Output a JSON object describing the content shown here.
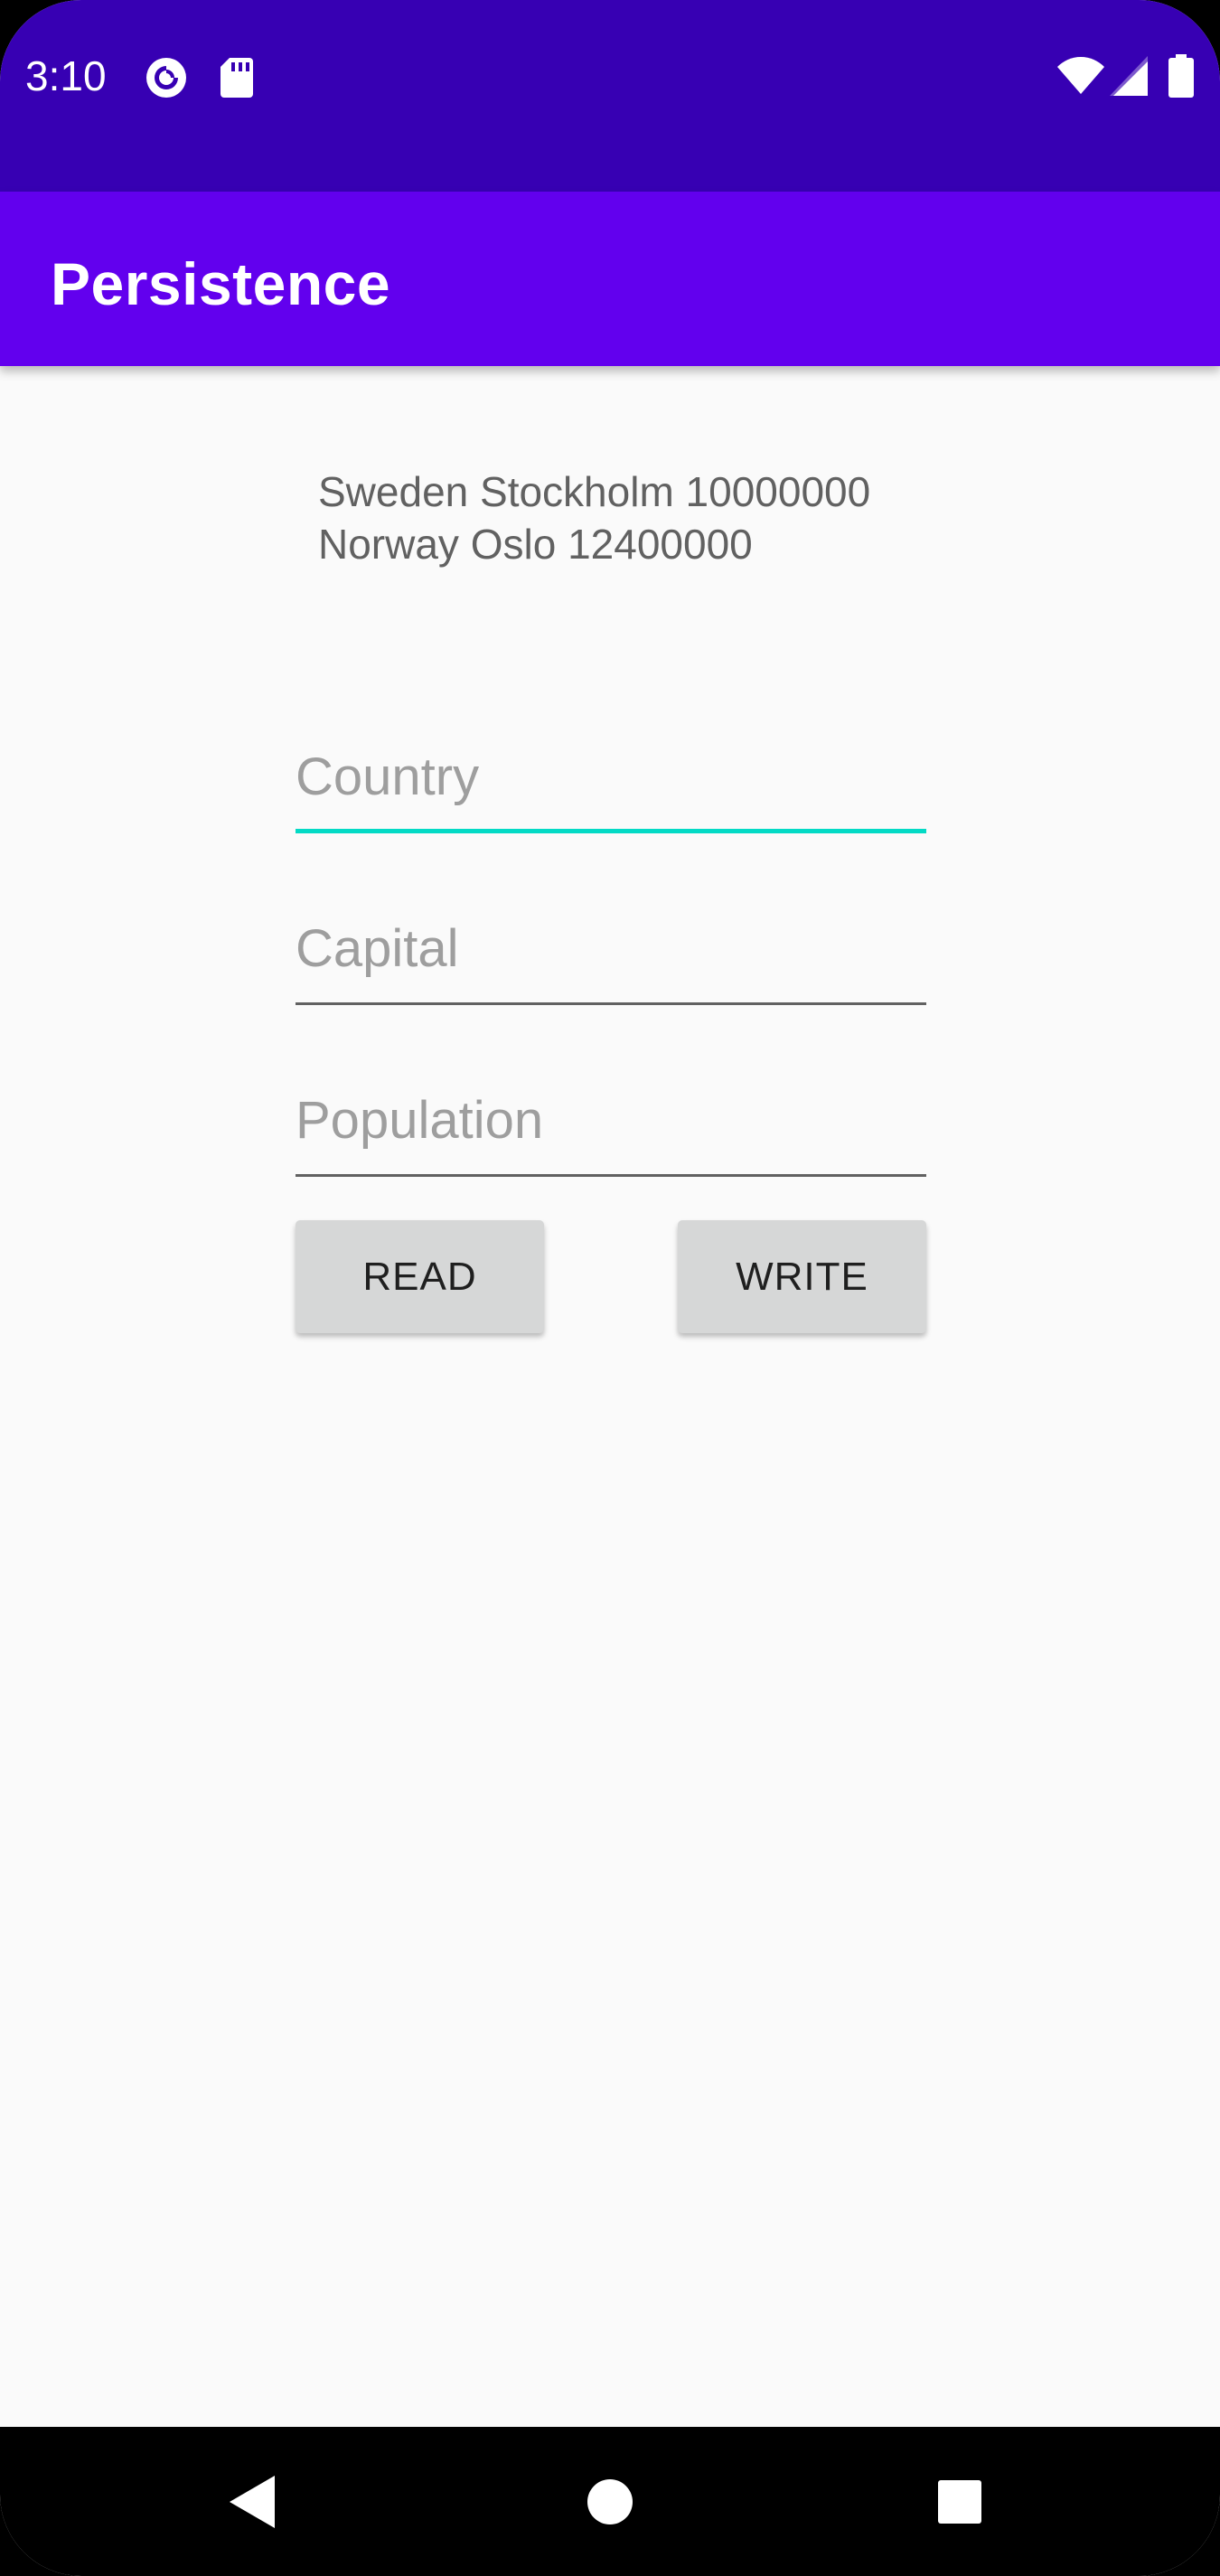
{
  "status_bar": {
    "time": "3:10",
    "icons_left": [
      "pocket-casts-icon",
      "sd-card-icon"
    ],
    "icons_right": [
      "wifi-icon",
      "cellular-signal-icon",
      "battery-icon"
    ],
    "background_color": "#3700b3"
  },
  "app_bar": {
    "title": "Persistence",
    "background_color": "#6200ee"
  },
  "output": {
    "text": "Sweden Stockholm 10000000\nNorway Oslo 12400000"
  },
  "form": {
    "country": {
      "placeholder": "Country",
      "value": ""
    },
    "capital": {
      "placeholder": "Capital",
      "value": ""
    },
    "population": {
      "placeholder": "Population",
      "value": ""
    },
    "accent_color": "#03dac5"
  },
  "buttons": {
    "read_label": "READ",
    "write_label": "WRITE"
  },
  "nav_bar": {
    "icons": [
      "back-icon",
      "home-icon",
      "recents-icon"
    ]
  }
}
